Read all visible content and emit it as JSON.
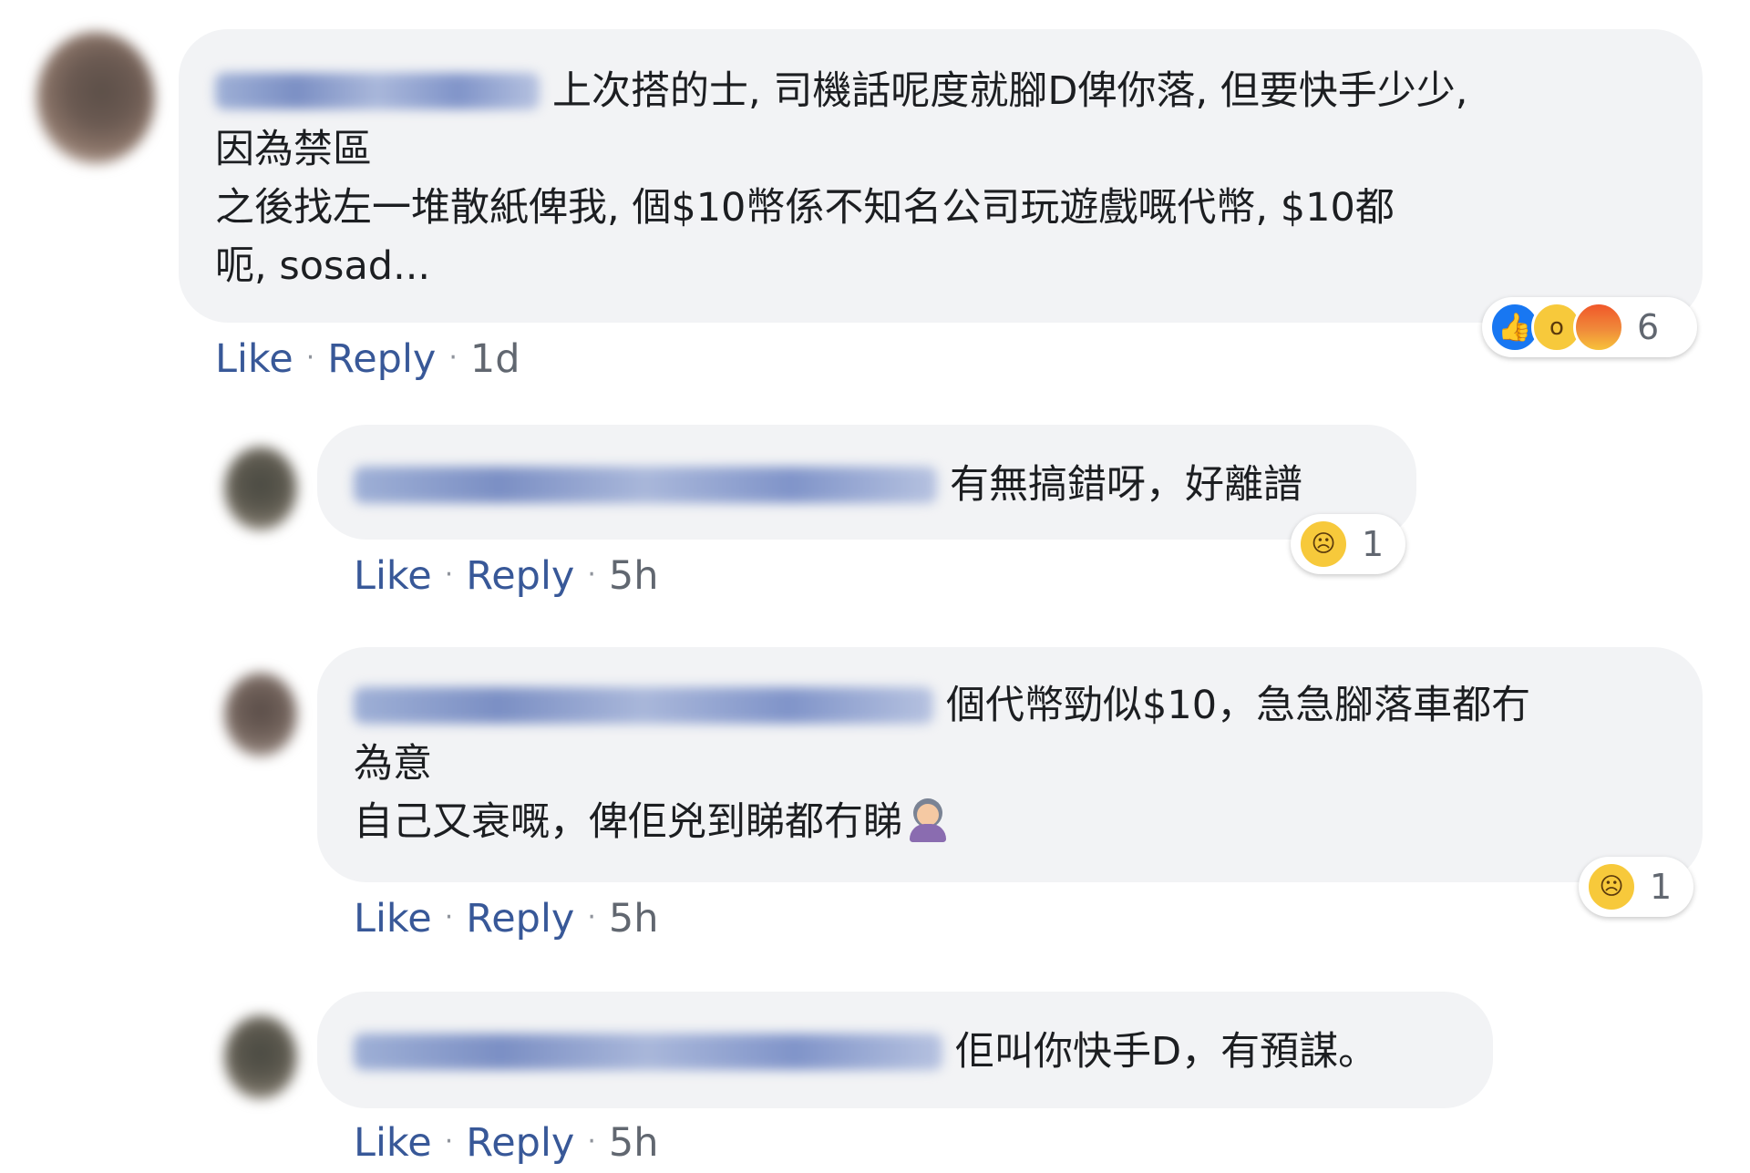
{
  "comments": [
    {
      "author_blurred": "Namnam Tang",
      "text": "上次搭的士, 司機話呢度就腳D俾你落, 但要快手少少,\n因為禁區\n之後找左一堆散紙俾我, 個$10幣係不知名公司玩遊戲嘅代幣, $10都\n呃, sosad...",
      "actions": {
        "like": "Like",
        "reply": "Reply",
        "time": "1d"
      },
      "reactions": {
        "icons": [
          "like-icon",
          "wow-icon",
          "angry-icon"
        ],
        "count": "6"
      }
    },
    {
      "author_blurred": "Mickey Lau Namnam Tang",
      "text": "有無搞錯呀，好離譜",
      "actions": {
        "like": "Like",
        "reply": "Reply",
        "time": "5h"
      },
      "reactions": {
        "icons": [
          "sad-icon"
        ],
        "count": "1"
      }
    },
    {
      "author_blurred": "Namnam Tang Mickey Lau",
      "text": "個代幣勁似$10，急急腳落車都冇\n為意\n自己又衰嘅，俾佢兇到睇都冇睇",
      "actions": {
        "like": "Like",
        "reply": "Reply",
        "time": "5h"
      },
      "reactions": {
        "icons": [
          "sad-icon"
        ],
        "count": "1"
      }
    },
    {
      "author_blurred": "Mickey Lau Namnam Tang",
      "text": "佢叫你快手D，有預謀。",
      "actions": {
        "like": "Like",
        "reply": "Reply",
        "time": "5h"
      }
    }
  ],
  "separator": "·",
  "colors": {
    "bubble": "#f2f3f5",
    "link": "#385898",
    "meta": "#616770",
    "like_blue": "#1877f2",
    "emoji_yellow": "#f7c93b"
  }
}
